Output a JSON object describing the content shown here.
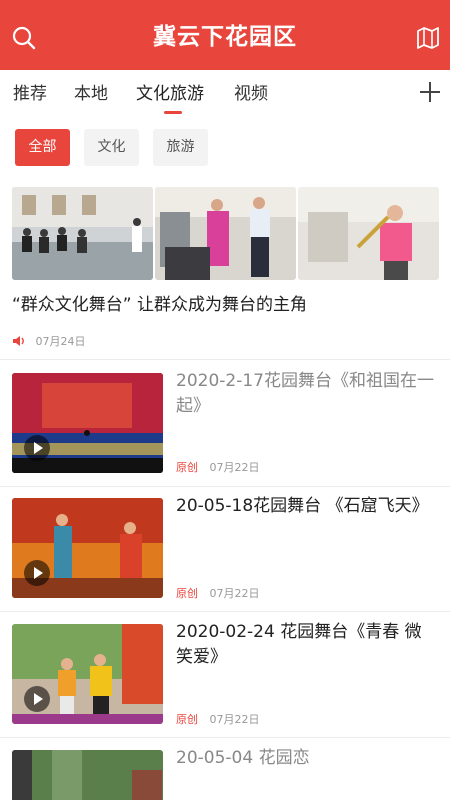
{
  "header": {
    "title": "冀云下花园区",
    "left_icon": "search-icon",
    "right_icon": "map-icon"
  },
  "tabs": [
    {
      "label": "推荐"
    },
    {
      "label": "本地"
    },
    {
      "label": "文化旅游",
      "active": true
    },
    {
      "label": "视频"
    }
  ],
  "filters": [
    {
      "label": "全部",
      "active": true
    },
    {
      "label": "文化"
    },
    {
      "label": "旅游"
    }
  ],
  "featured": {
    "title": "“群众文化舞台” 让群众成为舞台的主角",
    "date": "07月24日",
    "icon": "speaker-icon"
  },
  "items": [
    {
      "title": "2020-2-17花园舞台《和祖国在一起》",
      "tag": "原创",
      "date": "07月22日",
      "read": true
    },
    {
      "title": "20-05-18花园舞台 《石窟飞天》",
      "tag": "原创",
      "date": "07月22日",
      "read": false
    },
    {
      "title": "2020-02-24 花园舞台《青春 微笑爱》",
      "tag": "原创",
      "date": "07月22日",
      "read": false
    },
    {
      "title": "20-05-04  花园恋",
      "read": true
    }
  ],
  "colors": {
    "accent": "#e8453c"
  }
}
